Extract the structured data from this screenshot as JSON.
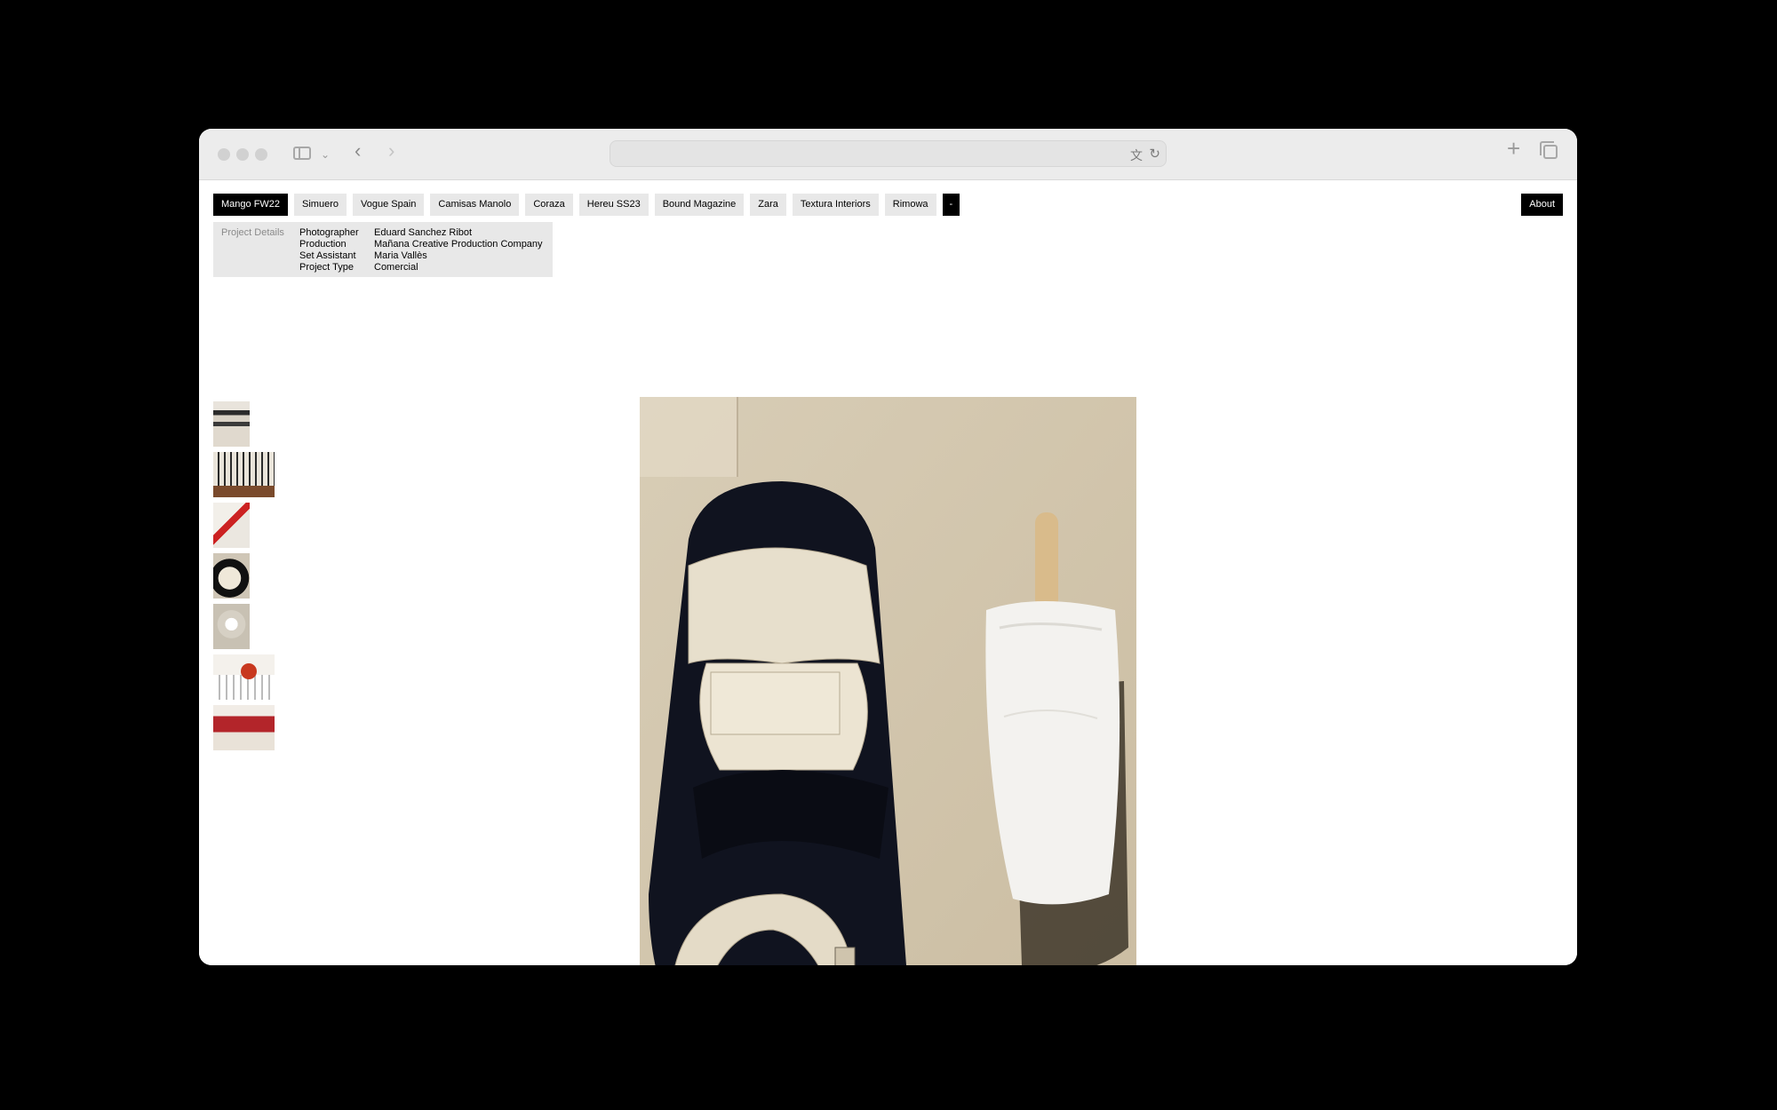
{
  "nav": {
    "items": [
      {
        "label": "Mango FW22",
        "active": true
      },
      {
        "label": "Simuero"
      },
      {
        "label": "Vogue Spain"
      },
      {
        "label": "Camisas Manolo"
      },
      {
        "label": "Coraza"
      },
      {
        "label": "Hereu SS23"
      },
      {
        "label": "Bound Magazine"
      },
      {
        "label": "Zara"
      },
      {
        "label": "Textura Interiors"
      },
      {
        "label": "Rimowa"
      },
      {
        "label": "-"
      }
    ],
    "about": "About"
  },
  "details": {
    "heading": "Project Details",
    "rows": [
      {
        "label": "Photographer",
        "value": "Eduard Sanchez Ribot"
      },
      {
        "label": "Production",
        "value": "Mañana Creative Production Company"
      },
      {
        "label": "Set Assistant",
        "value": "Maria Vallès"
      },
      {
        "label": "Project Type",
        "value": "Comercial"
      }
    ]
  },
  "thumbnails": [
    "shelf-stack",
    "brush-row",
    "red-paper",
    "shoe-top",
    "white-chair",
    "tomato-rack",
    "red-basket"
  ],
  "main_image": "shoe-and-ice-cream",
  "browser": {
    "url": ""
  },
  "colors": {
    "accent": "#000000",
    "chip_bg": "#e8e8e8",
    "backdrop": "#000000"
  }
}
